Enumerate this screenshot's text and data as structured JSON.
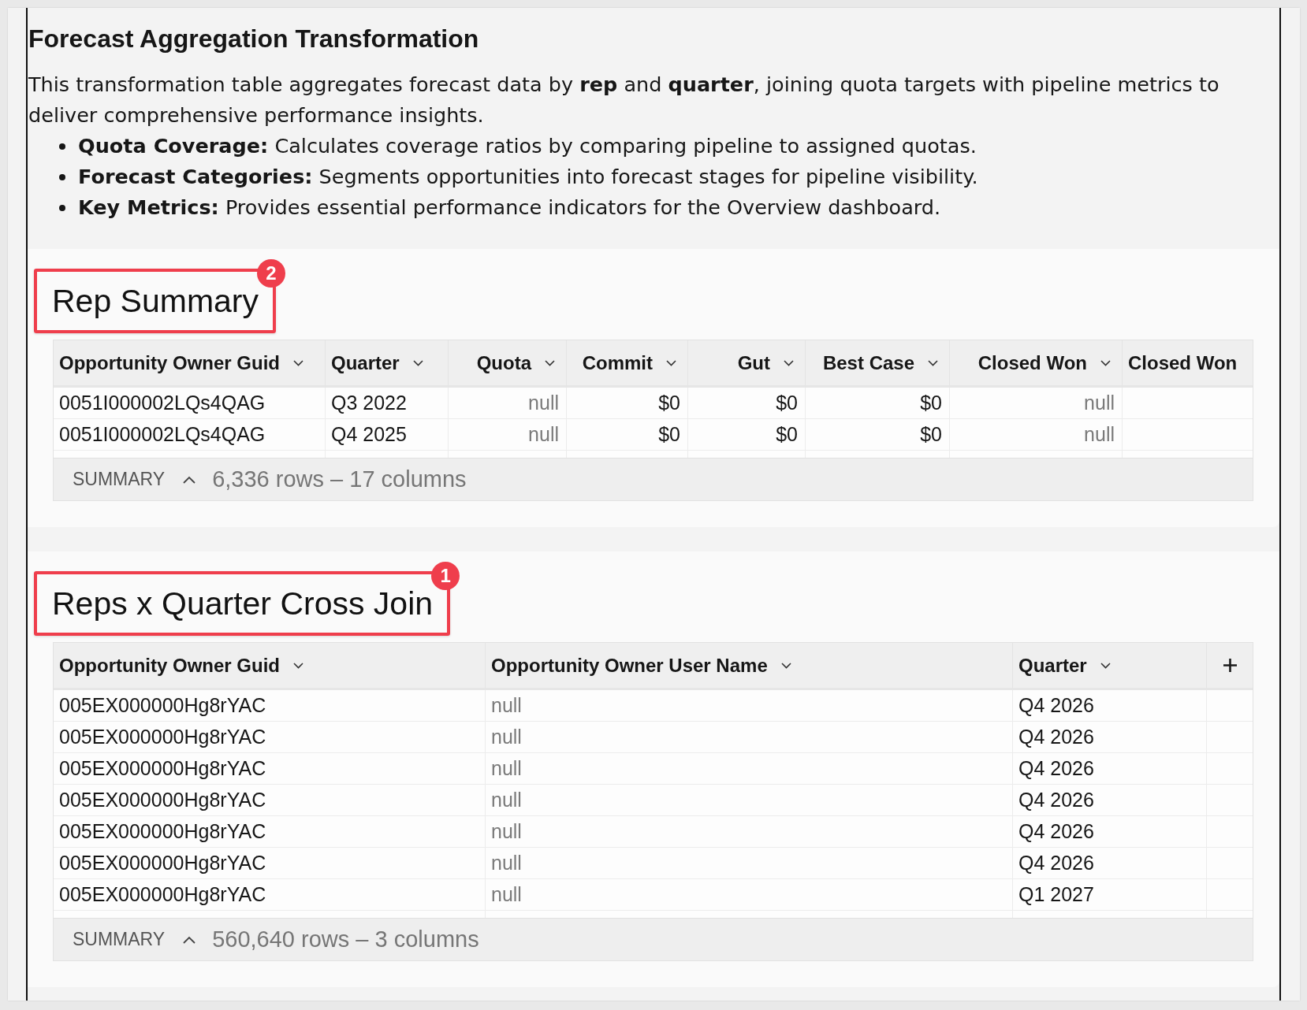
{
  "intro": {
    "title": "Forecast Aggregation Transformation",
    "text": "This transformation table aggregates forecast data by **rep** and **quarter**, joining quota targets with pipeline metrics to deliver comprehensive performance insights.",
    "bullets": [
      "**Quota Coverage:** Calculates coverage ratios by comparing pipeline to assigned quotas.",
      "**Forecast Categories:** Segments opportunities into forecast stages for pipeline visibility.",
      "**Key Metrics:** Provides essential performance indicators for the Overview dashboard."
    ]
  },
  "sections": [
    {
      "title": "Rep Summary",
      "badge": "2",
      "table": {
        "columns": [
          {
            "label": "Opportunity Owner Guid",
            "kind": "text",
            "menu": true
          },
          {
            "label": "Quarter",
            "kind": "text",
            "menu": true
          },
          {
            "label": "Quota",
            "kind": "number",
            "menu": true
          },
          {
            "label": "Commit",
            "kind": "number",
            "menu": true
          },
          {
            "label": "Gut",
            "kind": "number",
            "menu": true
          },
          {
            "label": "Best Case",
            "kind": "number",
            "menu": true
          },
          {
            "label": "Closed Won",
            "kind": "number",
            "menu": true
          },
          {
            "label": "Closed Won",
            "kind": "text",
            "menu": false
          }
        ],
        "rows": [
          {
            "cells": [
              {
                "text": "0051I000002LQs4QAG",
                "missing": false
              },
              {
                "text": "Q3 2022",
                "missing": false
              },
              {
                "text": "null",
                "missing": true
              },
              {
                "text": "$0",
                "missing": false
              },
              {
                "text": "$0",
                "missing": false
              },
              {
                "text": "$0",
                "missing": false
              },
              {
                "text": "null",
                "missing": true
              }
            ]
          },
          {
            "cells": [
              {
                "text": "0051I000002LQs4QAG",
                "missing": false
              },
              {
                "text": "Q4 2025",
                "missing": false
              },
              {
                "text": "null",
                "missing": true
              },
              {
                "text": "$0",
                "missing": false
              },
              {
                "text": "$0",
                "missing": false
              },
              {
                "text": "$0",
                "missing": false
              },
              {
                "text": "null",
                "missing": true
              }
            ]
          }
        ],
        "summary": {
          "label": "SUMMARY",
          "count": "6,336 rows – 17 columns"
        }
      }
    },
    {
      "title": "Reps x Quarter Cross Join",
      "badge": "1",
      "table": {
        "columns": [
          {
            "label": "Opportunity Owner Guid",
            "kind": "text",
            "menu": true
          },
          {
            "label": "Opportunity Owner User Name",
            "kind": "text",
            "menu": true
          },
          {
            "label": "Quarter",
            "kind": "text",
            "menu": true
          }
        ],
        "add_column": true,
        "rows": [
          {
            "cells": [
              {
                "text": "005EX000000Hg8rYAC",
                "missing": false
              },
              {
                "text": "null",
                "missing": true
              },
              {
                "text": "Q4 2026",
                "missing": false
              }
            ]
          },
          {
            "cells": [
              {
                "text": "005EX000000Hg8rYAC",
                "missing": false
              },
              {
                "text": "null",
                "missing": true
              },
              {
                "text": "Q4 2026",
                "missing": false
              }
            ]
          },
          {
            "cells": [
              {
                "text": "005EX000000Hg8rYAC",
                "missing": false
              },
              {
                "text": "null",
                "missing": true
              },
              {
                "text": "Q4 2026",
                "missing": false
              }
            ]
          },
          {
            "cells": [
              {
                "text": "005EX000000Hg8rYAC",
                "missing": false
              },
              {
                "text": "null",
                "missing": true
              },
              {
                "text": "Q4 2026",
                "missing": false
              }
            ]
          },
          {
            "cells": [
              {
                "text": "005EX000000Hg8rYAC",
                "missing": false
              },
              {
                "text": "null",
                "missing": true
              },
              {
                "text": "Q4 2026",
                "missing": false
              }
            ]
          },
          {
            "cells": [
              {
                "text": "005EX000000Hg8rYAC",
                "missing": false
              },
              {
                "text": "null",
                "missing": true
              },
              {
                "text": "Q4 2026",
                "missing": false
              }
            ]
          },
          {
            "cells": [
              {
                "text": "005EX000000Hg8rYAC",
                "missing": false
              },
              {
                "text": "null",
                "missing": true
              },
              {
                "text": "Q1 2027",
                "missing": false
              }
            ]
          }
        ],
        "summary": {
          "label": "SUMMARY",
          "count": "560,640 rows – 3 columns"
        }
      }
    }
  ]
}
